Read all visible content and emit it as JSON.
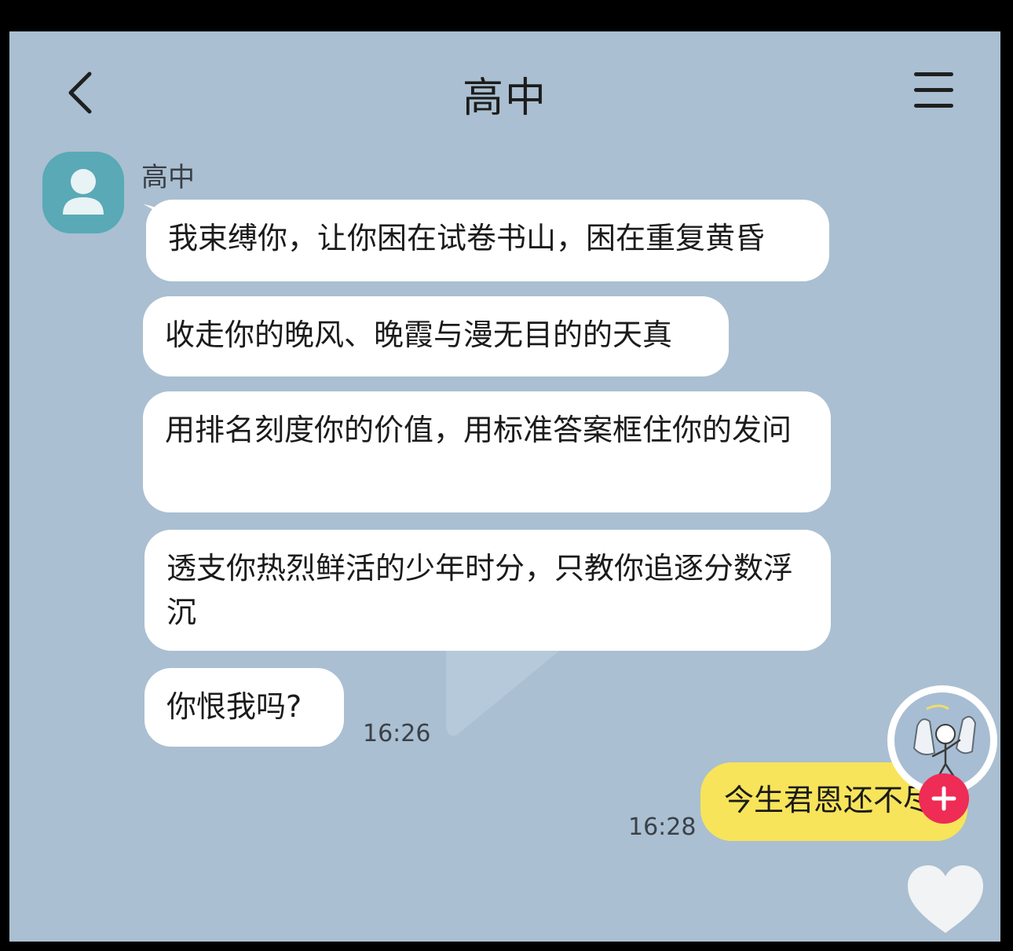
{
  "header": {
    "title": "高中"
  },
  "contact": {
    "name": "高中"
  },
  "messages_in": [
    {
      "text": "我束缚你，让你困在试卷书山，困在重复黄昏"
    },
    {
      "text": "收走你的晚风、晚霞与漫无目的的天真"
    },
    {
      "text": "用排名刻度你的价值，用标准答案框住你的发问"
    },
    {
      "text": "透支你热烈鲜活的少年时分，只教你追逐分数浮沉"
    },
    {
      "text": "你恨我吗?",
      "time": "16:26"
    }
  ],
  "message_out": {
    "text": "今生君恩还不尽",
    "time": "16:28"
  },
  "colors": {
    "background": "#aabfd1",
    "incoming_bubble": "#ffffff",
    "outgoing_bubble": "#f7e45a",
    "avatar": "#59a9b6",
    "follow_button": "#ee2c55"
  },
  "icons": {
    "back": "chevron-left-icon",
    "menu": "hamburger-menu-icon",
    "avatar": "person-icon",
    "follow": "plus-icon",
    "like": "heart-icon"
  }
}
